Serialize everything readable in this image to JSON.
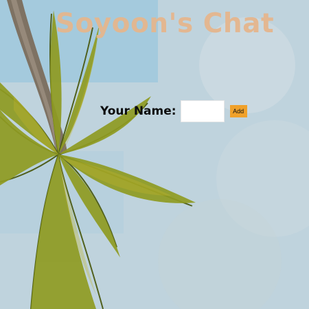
{
  "page": {
    "title": "Soyoon's Chat"
  },
  "form": {
    "name_label": "Your Name:",
    "name_value": "",
    "name_placeholder": "",
    "add_button_label": "Add"
  },
  "colors": {
    "title": "#e5b68d",
    "button": "#f0a12a",
    "text": "#0d0d0d"
  },
  "background": {
    "description_icon": "palm-tree-background"
  }
}
